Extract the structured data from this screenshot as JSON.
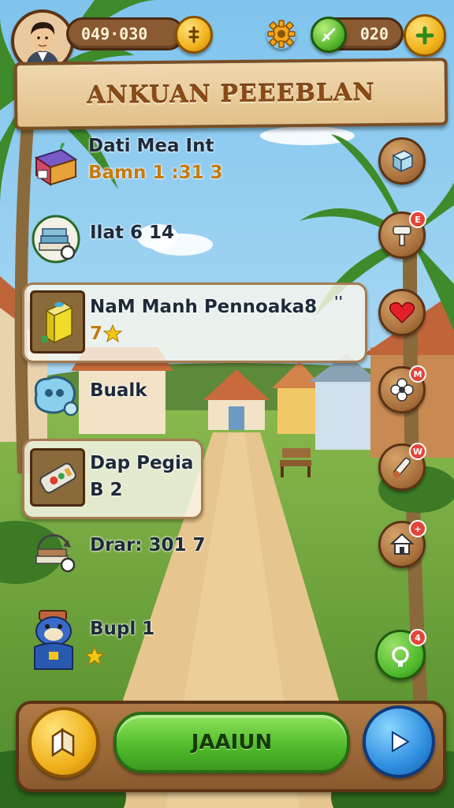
{
  "hud": {
    "coins": "049·030",
    "gems": "020",
    "coin_icon": "coin-icon",
    "settings_icon": "gear-icon",
    "add_icon": "plus-icon"
  },
  "banner": {
    "title": "ANKUAN PEEEBLAN"
  },
  "quests": [
    {
      "title": "Dati Mea Int",
      "subtitle": "Bamn 1 :31 3",
      "icon": "gift-box-icon"
    },
    {
      "title": "Ilat 6 14",
      "subtitle": "",
      "icon": "books-icon"
    },
    {
      "title": "NaM Manh Pennoaka8",
      "subtitle": "7",
      "extra": "''",
      "icon": "drink-can-icon"
    },
    {
      "title": "Bualk",
      "subtitle": "",
      "icon": "blob-icon"
    },
    {
      "title": "Dap Pegia",
      "subtitle": "B 2",
      "icon": "chest-icon"
    },
    {
      "title": "Drar: 301 7",
      "subtitle": "",
      "icon": "book-icon"
    },
    {
      "title": "Bupl 1",
      "subtitle": "",
      "icon": "character-icon"
    }
  ],
  "side_buttons": [
    {
      "icon": "cube-icon",
      "badge": ""
    },
    {
      "icon": "hammer-icon",
      "badge": "E"
    },
    {
      "icon": "heart-icon",
      "badge": ""
    },
    {
      "icon": "flower-icon",
      "badge": "M"
    },
    {
      "icon": "tool-icon",
      "badge": "W"
    },
    {
      "icon": "home-icon",
      "badge": "+"
    },
    {
      "icon": "refresh-icon",
      "badge": "4"
    }
  ],
  "bottom": {
    "play_label": "JAAIUN",
    "left_icon": "map-icon",
    "right_icon": "play-icon"
  },
  "colors": {
    "accent_green": "#4fb92b",
    "wood": "#8a5a2e",
    "gold": "#f0b21c",
    "sky": "#8ecff0"
  }
}
